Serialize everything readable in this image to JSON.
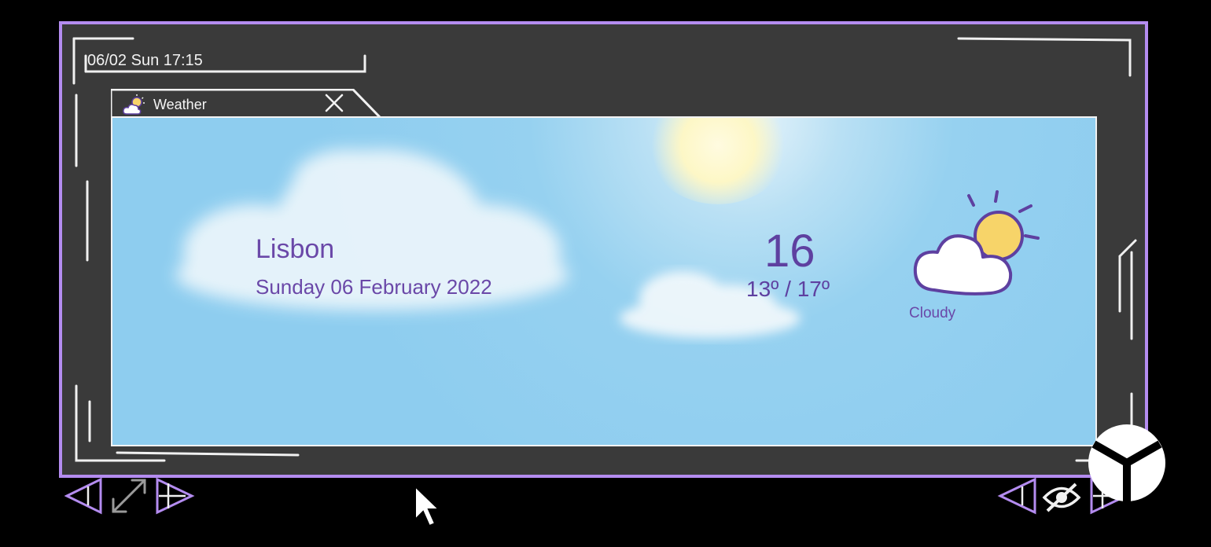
{
  "status_bar": {
    "clock": "06/02 Sun 17:15"
  },
  "window": {
    "title": "Weather",
    "icon": "weather-app-icon",
    "close_icon": "close-icon"
  },
  "weather": {
    "city": "Lisbon",
    "date": "Sunday 06 February 2022",
    "temperature": "16",
    "range": "13º / 17º",
    "condition": "Cloudy",
    "condition_icon": "partly-cloudy-icon"
  },
  "controls": {
    "left": [
      "nav-left-icon",
      "expand-icon",
      "nav-right-icon"
    ],
    "right": [
      "nav-left-icon",
      "hide-icon",
      "nav-right-icon",
      "logo-icon"
    ]
  },
  "colors": {
    "frame_border": "#b48cf0",
    "frame_bg": "#3a3a3a",
    "text_purple": "#6a48a8",
    "sky": "#8ecdef"
  }
}
